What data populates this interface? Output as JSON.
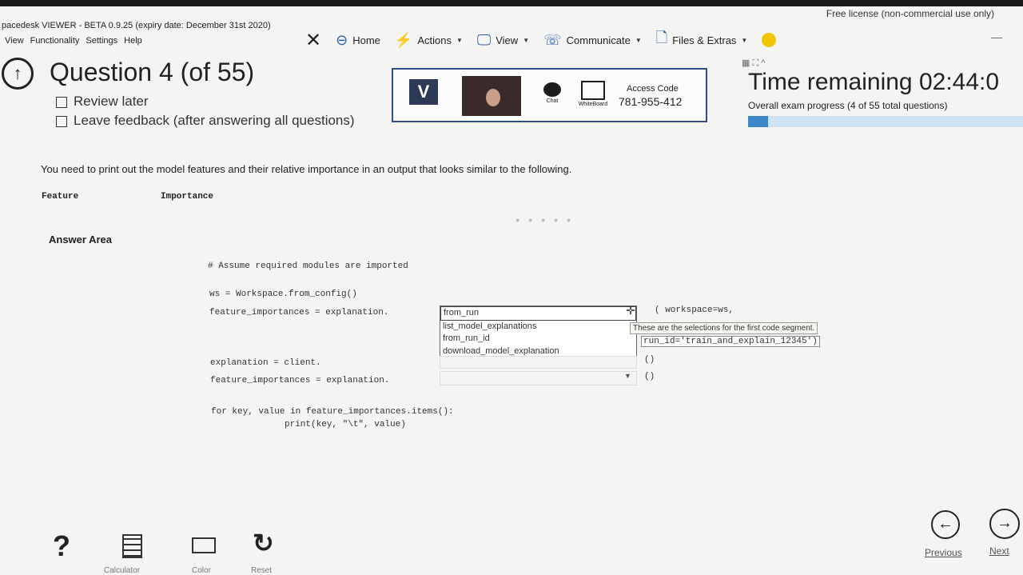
{
  "license": "Free license (non-commercial use only)",
  "viewer": {
    "title": "pacedesk VIEWER - BETA 0.9.25 (expiry date: December 31st 2020)",
    "menu": [
      "View",
      "Functionality",
      "Settings",
      "Help"
    ]
  },
  "toolbar": {
    "close": "✕",
    "home": "Home",
    "actions": "Actions",
    "view": "View",
    "communicate": "Communicate",
    "files": "Files & Extras"
  },
  "question": {
    "title": "Question 4 (of 55)",
    "review_later": "Review later",
    "leave_feedback": "Leave feedback (after answering all questions)"
  },
  "remote": {
    "logo": "V",
    "chat": "Chat",
    "whiteboard": "WhiteBoard",
    "access_label": "Access Code",
    "access_code": "781-955-412"
  },
  "timer": {
    "time_remaining": "Time remaining 02:44:0",
    "progress_label": "Overall exam progress (4 of 55 total questions)",
    "progress_value": 0.0727
  },
  "body": {
    "prompt": "You need to print out the model features and their relative importance in an output that looks similar to the following.",
    "header_feature": "Feature",
    "header_importance": "Importance",
    "answer_area": "Answer Area",
    "code": {
      "comment": "# Assume required modules are imported",
      "ws": "ws = Workspace.from_config()",
      "fi1": "feature_importances = explanation.",
      "expl": "explanation = client.",
      "fi2": "feature_importances = explanation.",
      "loop1": "for key, value in feature_importances.items():",
      "loop2": "print(key, \"\\t\", value)",
      "arg1": "( workspace=ws,",
      "arg2": "run_id='train_and_explain_12345')",
      "paren1": "()",
      "paren2": "()"
    },
    "dropdown1": {
      "options": [
        "from_run",
        "list_model_explanations",
        "from_run_id",
        "download_model_explanation"
      ]
    },
    "tooltip": "These are the selections for the first code segment."
  },
  "bottom": {
    "calculator": "Calculator",
    "color": "Color",
    "reset": "Reset",
    "previous": "Previous",
    "next": "Next"
  }
}
